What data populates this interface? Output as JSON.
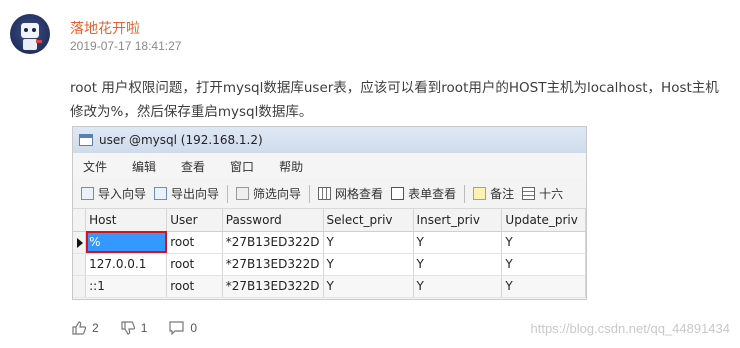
{
  "post": {
    "username": "落地花开啦",
    "timestamp": "2019-07-17 18:41:27",
    "text": "root 用户权限问题，打开mysql数据库user表，应该可以看到root用户的HOST主机为localhost，Host主机修改为%，然后保存重启mysql数据库。"
  },
  "screenshot": {
    "window_title": "user @mysql (192.168.1.2)",
    "menu": [
      "文件",
      "编辑",
      "查看",
      "窗口",
      "帮助"
    ],
    "toolbar": [
      "导入向导",
      "导出向导",
      "筛选向导",
      "网格查看",
      "表单查看",
      "备注",
      "十六"
    ],
    "columns": [
      "Host",
      "User",
      "Password",
      "Select_priv",
      "Insert_priv",
      "Update_priv"
    ],
    "rows": [
      [
        "%",
        "root",
        "*27B13ED322D",
        "Y",
        "Y",
        "Y"
      ],
      [
        "127.0.0.1",
        "root",
        "*27B13ED322D",
        "Y",
        "Y",
        "Y"
      ],
      [
        "::1",
        "root",
        "*27B13ED322D",
        "Y",
        "Y",
        "Y"
      ]
    ],
    "highlight_color": "#d4141c",
    "selection_color": "#3399ff"
  },
  "actions": {
    "likes": "2",
    "dislikes": "1",
    "comments": "0"
  },
  "watermark": "https://blog.csdn.net/qq_44891434",
  "colors": {
    "username": "#e5642d",
    "timestamp": "#8a8a8a"
  }
}
